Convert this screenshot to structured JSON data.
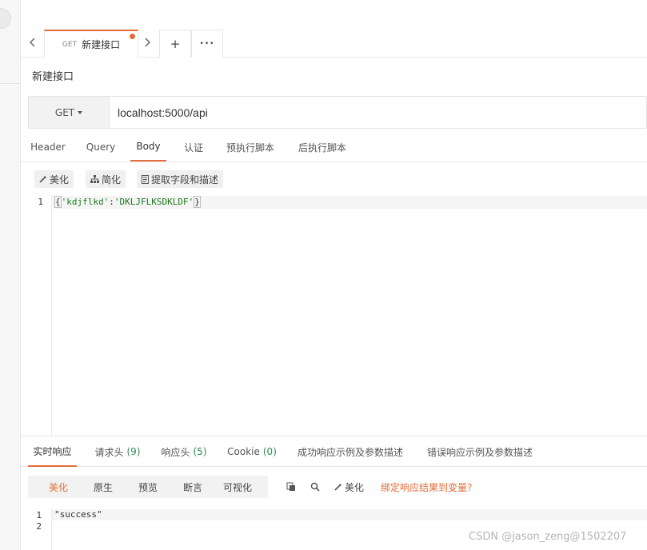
{
  "tabbar": {
    "prev_icon": "chevron-left-icon",
    "next_icon": "chevron-right-icon",
    "active_tab": {
      "method": "GET",
      "name": "新建接口",
      "unsaved": true
    },
    "add_label": "+",
    "more_label": "•••"
  },
  "page": {
    "title": "新建接口"
  },
  "request": {
    "method": "GET",
    "url": "localhost:5000/api"
  },
  "request_tabs": [
    "Header",
    "Query",
    "Body",
    "认证",
    "预执行脚本",
    "后执行脚本"
  ],
  "active_request_tab": "Body",
  "body_toolbar": {
    "beautify": "美化",
    "simplify": "简化",
    "extract": "提取字段和描述"
  },
  "body_editor": {
    "line_numbers": [
      "1"
    ],
    "content_open": "{",
    "content_key": "'kdjflkd'",
    "content_sep": ":",
    "content_val": "'DKLJFLKSDKLDF'",
    "content_close": "}"
  },
  "response_tabs": {
    "realtime": "实时响应",
    "req_headers": "请求头",
    "req_headers_count": "(9)",
    "resp_headers": "响应头",
    "resp_headers_count": "(5)",
    "cookie": "Cookie",
    "cookie_count": "(0)",
    "success_example": "成功响应示例及参数描述",
    "error_example": "错误响应示例及参数描述"
  },
  "response_toolbar": {
    "modes": [
      "美化",
      "原生",
      "预览",
      "断言",
      "可视化"
    ],
    "active_mode": "美化",
    "beautify": "美化",
    "bind_link": "绑定响应结果到变量?"
  },
  "response_editor": {
    "line_numbers": [
      "1",
      "2"
    ],
    "line1": "\"success\""
  },
  "watermark": "CSDN @jason_zeng@1502207",
  "colors": {
    "accent": "#e56c3a",
    "count": "#2e8b57",
    "string": "#1a7a1a"
  }
}
